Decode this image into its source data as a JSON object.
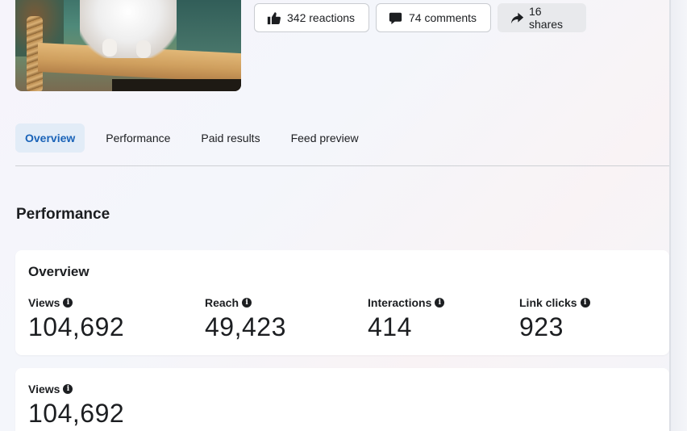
{
  "post": {
    "engagement": {
      "reactions_label": "342 reactions",
      "comments_label": "74 comments",
      "shares_label": "16 shares"
    }
  },
  "tabs": [
    {
      "label": "Overview",
      "active": true
    },
    {
      "label": "Performance",
      "active": false
    },
    {
      "label": "Paid results",
      "active": false
    },
    {
      "label": "Feed preview",
      "active": false
    }
  ],
  "section_title": "Performance",
  "overview_card": {
    "title": "Overview",
    "metrics": [
      {
        "label": "Views",
        "value": "104,692"
      },
      {
        "label": "Reach",
        "value": "49,423"
      },
      {
        "label": "Interactions",
        "value": "414"
      },
      {
        "label": "Link clicks",
        "value": "923"
      }
    ]
  },
  "views_card": {
    "label": "Views",
    "value": "104,692"
  },
  "icons": {
    "reactions": "thumbs-up-icon",
    "comments": "comment-bubble-icon",
    "shares": "share-arrow-icon",
    "info": "info-icon"
  },
  "colors": {
    "active_tab_bg": "#e2ecf7",
    "active_tab_text": "#1a63b8",
    "text": "#1c1e21"
  }
}
